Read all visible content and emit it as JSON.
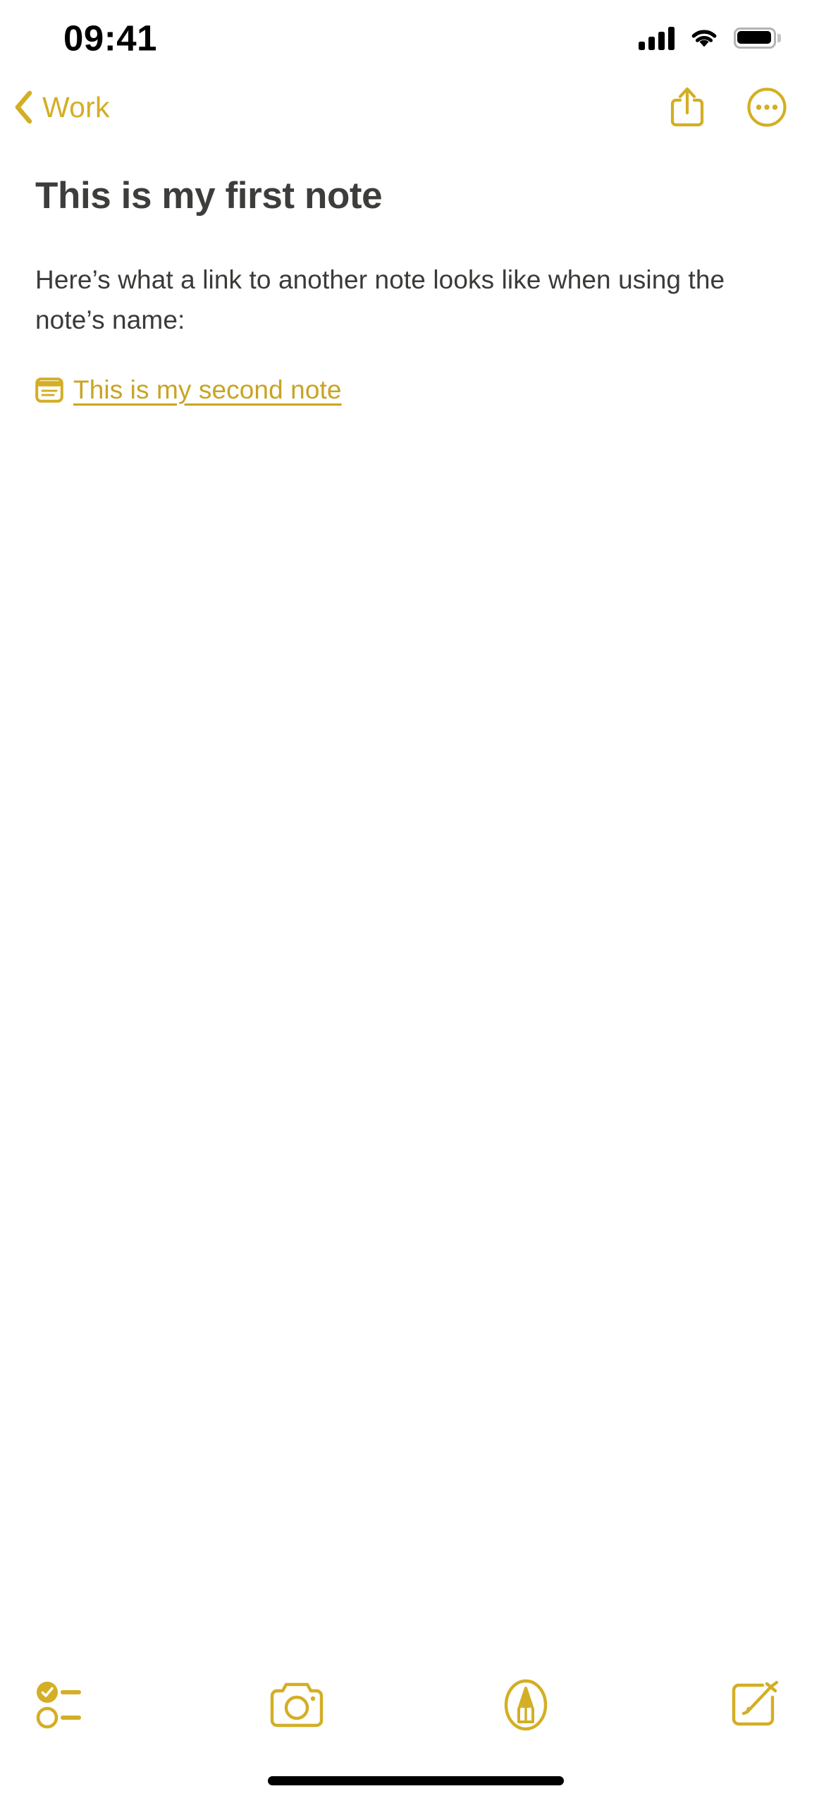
{
  "status_bar": {
    "time": "09:41",
    "cellular_icon": "signal-bars-icon",
    "wifi_icon": "wifi-icon",
    "battery_icon": "battery-full-icon"
  },
  "nav_bar": {
    "back_label": "Work",
    "back_icon": "chevron-left-icon",
    "share_icon": "share-icon",
    "more_icon": "ellipsis-circle-icon"
  },
  "note": {
    "title": "This is my first note",
    "paragraph": "Here’s what a link to another note looks like when using the note’s name:",
    "link": {
      "label": "This is my second note",
      "icon": "note-icon"
    }
  },
  "toolbar": {
    "items": [
      {
        "name": "checklist",
        "icon": "checklist-icon"
      },
      {
        "name": "camera",
        "icon": "camera-icon"
      },
      {
        "name": "markup",
        "icon": "markup-pen-icon"
      },
      {
        "name": "compose",
        "icon": "compose-icon"
      }
    ]
  },
  "colors": {
    "accent": "#D4AE24",
    "link": "#C9A423",
    "title_text": "#3d3d3b",
    "body_text": "#3a3a38",
    "background": "#ffffff",
    "home_indicator": "#000000"
  }
}
